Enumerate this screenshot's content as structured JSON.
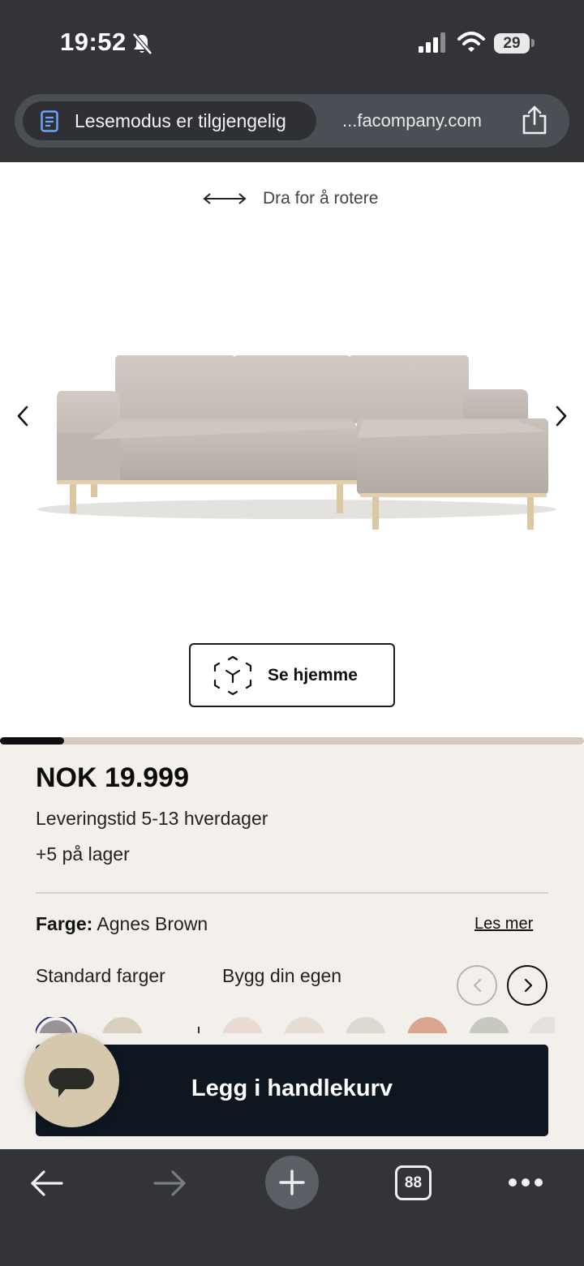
{
  "status_bar": {
    "time": "19:52",
    "battery": "29"
  },
  "url_bar": {
    "reader_mode_label": "Lesemodus er tilgjengelig",
    "domain": "...facompany.com"
  },
  "viewer": {
    "rotate_hint": "Dra for å rotere",
    "ar_button_label": "Se hjemme",
    "gallery_progress": 0.11
  },
  "product": {
    "price": "NOK 19.999",
    "delivery": "Leveringstid 5-13 hverdager",
    "stock": "+5 på lager",
    "color_label": "Farge:",
    "color_value": "Agnes Brown",
    "read_more": "Les mer",
    "tabs": [
      "Standard farger",
      "Bygg din egen"
    ],
    "swatch_colors": [
      "#9a9296",
      "#d8d0bd",
      "#eadbd2",
      "#e6ddd2",
      "#ddd8d2",
      "#d9a58f",
      "#c7c9bf",
      "#e5e1dc"
    ],
    "add_to_cart": "Legg i handlekurv"
  },
  "toolbar": {
    "tab_count": "88"
  },
  "colors": {
    "chrome_bg": "#323438",
    "info_bg": "#f3f0eb",
    "cart_bg": "#0e1620",
    "chat_bg": "#d6c8ad",
    "progress_track": "#d4c9bd"
  }
}
